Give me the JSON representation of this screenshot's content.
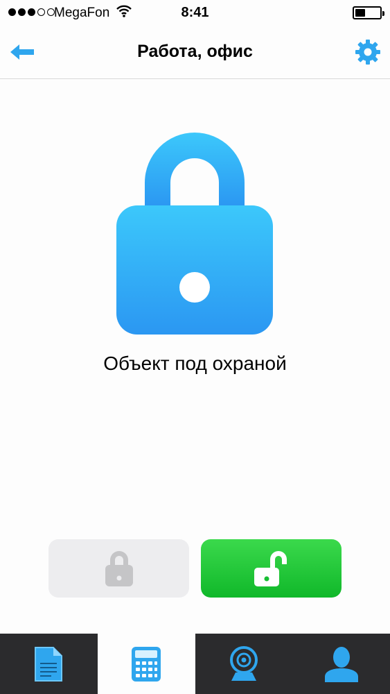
{
  "status_bar": {
    "carrier": "MegaFon",
    "time": "8:41",
    "signal_bars_filled": 3,
    "signal_bars_total": 5,
    "battery_level": 0.4
  },
  "nav": {
    "title": "Работа, офис",
    "back_icon": "arrow-left-icon",
    "settings_icon": "gear-icon"
  },
  "main": {
    "lock_state": "locked",
    "lock_icon": "padlock-closed-icon",
    "status_text": "Объект под охраной"
  },
  "actions": {
    "arm": {
      "icon": "padlock-closed-icon",
      "enabled": false
    },
    "disarm": {
      "icon": "padlock-open-icon",
      "enabled": true
    }
  },
  "tab_bar": {
    "active_index": 1,
    "tabs": [
      {
        "icon": "document-icon"
      },
      {
        "icon": "calculator-icon"
      },
      {
        "icon": "webcam-icon"
      },
      {
        "icon": "user-icon"
      }
    ]
  },
  "colors": {
    "accent": "#2fa6ee",
    "lock_gradient_top": "#3cc8fb",
    "lock_gradient_bottom": "#2b97f2",
    "disarm_green": "#1ec83a",
    "tab_bar_bg": "#2b2b2d"
  }
}
